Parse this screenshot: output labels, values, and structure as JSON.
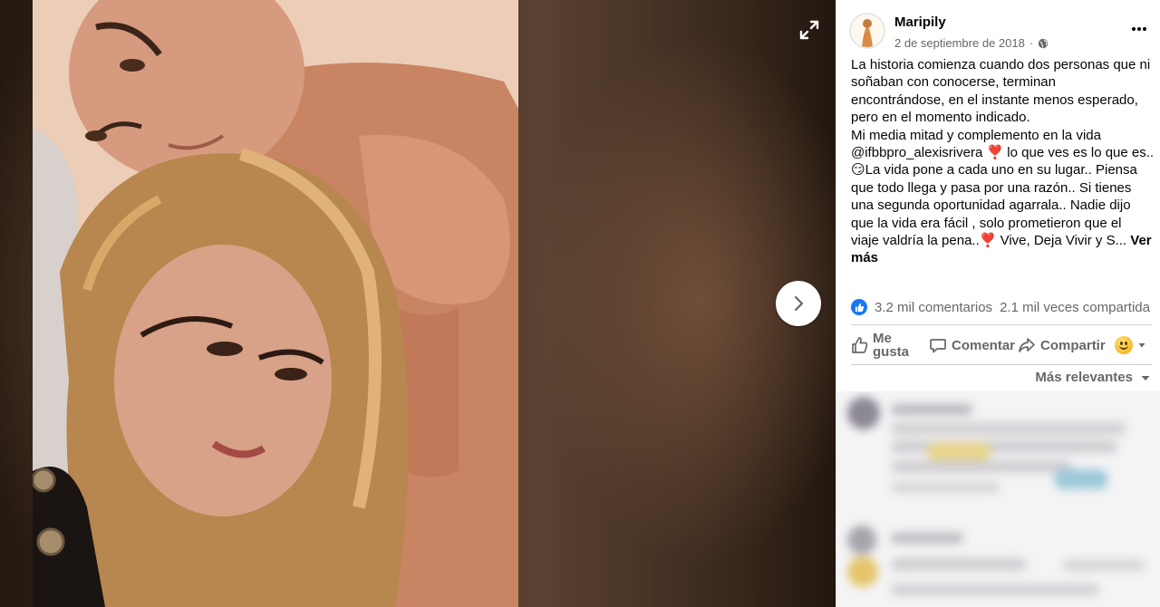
{
  "viewer": {
    "expand_icon": "expand-arrows-icon",
    "next_icon": "chevron-right-icon"
  },
  "post": {
    "author": "Maripily",
    "date": "2 de septiembre de 2018",
    "privacy_icon": "globe-icon",
    "text_lines": [
      "La historia comienza cuando dos personas que ni",
      "soñaban con conocerse, terminan",
      "encontrándose, en el instante menos esperado,",
      "pero en el momento indicado.",
      "Mi media mitad y complemento en la vida",
      "@ifbbpro_alexisrivera ❣️ lo que ves es lo que es..",
      "😏La vida pone a cada uno en su lugar.. Piensa",
      "que todo llega y pasa por una razón.. Si tienes",
      "una segunda oportunidad agarrala.. Nadie dijo",
      "que la vida era fácil , solo prometieron que el",
      "viaje valdría la pena..❣️ Vive, Deja Vivir y S..."
    ],
    "see_more_1": "Ver",
    "see_more_2": "más"
  },
  "stats": {
    "comments": "3.2 mil comentarios",
    "shares": "2.1 mil veces compartida"
  },
  "actions": {
    "like": "Me gusta",
    "comment": "Comentar",
    "share": "Compartir"
  },
  "comments_sort": "Más relevantes",
  "colors": {
    "facebook_blue": "#1877f2",
    "secondary_text": "#65676b",
    "divider": "#ced0d4"
  }
}
